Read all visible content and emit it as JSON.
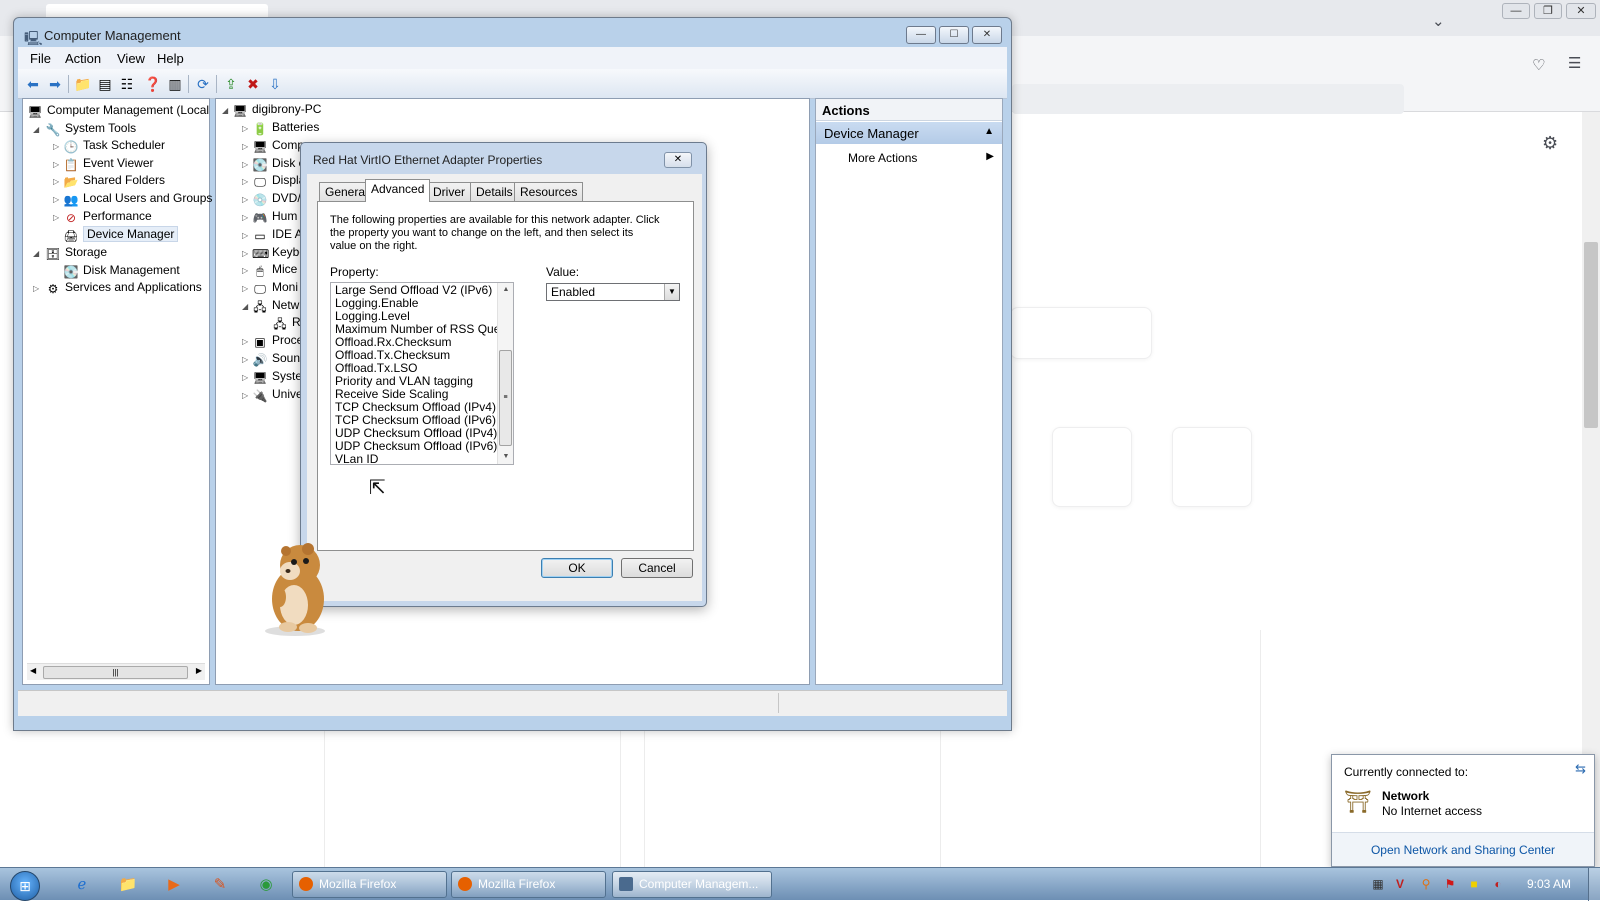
{
  "computer_management": {
    "title": "Computer Management",
    "menu": [
      "File",
      "Action",
      "View",
      "Help"
    ],
    "left_tree": {
      "root": "Computer Management (Local",
      "system_tools": "System Tools",
      "task_scheduler": "Task Scheduler",
      "event_viewer": "Event Viewer",
      "shared_folders": "Shared Folders",
      "local_users": "Local Users and Groups",
      "performance": "Performance",
      "device_manager": "Device Manager",
      "storage": "Storage",
      "disk_management": "Disk Management",
      "services": "Services and Applications"
    },
    "device_tree": {
      "root": "digibrony-PC",
      "items": [
        "Batteries",
        "Compu",
        "Disk c",
        "Displa",
        "DVD/",
        "Hum",
        "IDE A",
        "Keybo",
        "Mice",
        "Moni",
        "Netw",
        "Re",
        "Proce",
        "Soun",
        "Syste",
        "Unive"
      ]
    },
    "actions": {
      "header": "Actions",
      "section": "Device Manager",
      "more": "More Actions"
    }
  },
  "dialog": {
    "title": "Red Hat VirtIO Ethernet Adapter Properties",
    "tabs": [
      "General",
      "Advanced",
      "Driver",
      "Details",
      "Resources"
    ],
    "active_tab": "Advanced",
    "description": "The following properties are available for this network adapter. Click the property you want to change on the left, and then select its value on the right.",
    "property_label": "Property:",
    "value_label": "Value:",
    "properties": [
      "Large Send Offload V2 (IPv6)",
      "Logging.Enable",
      "Logging.Level",
      "Maximum Number of RSS Queues",
      "Offload.Rx.Checksum",
      "Offload.Tx.Checksum",
      "Offload.Tx.LSO",
      "Priority and VLAN tagging",
      "Receive Side Scaling",
      "TCP Checksum Offload (IPv4)",
      "TCP Checksum Offload (IPv6)",
      "UDP Checksum Offload (IPv4)",
      "UDP Checksum Offload (IPv6)",
      "VLan ID"
    ],
    "value": "Enabled",
    "ok": "OK",
    "cancel": "Cancel"
  },
  "network_popup": {
    "header": "Currently connected to:",
    "network_name": "Network",
    "status": "No Internet access",
    "link": "Open Network and Sharing Center"
  },
  "taskbar": {
    "tasks": [
      "Mozilla Firefox",
      "Mozilla Firefox",
      "Computer Managem..."
    ],
    "time": "9:03 AM"
  }
}
